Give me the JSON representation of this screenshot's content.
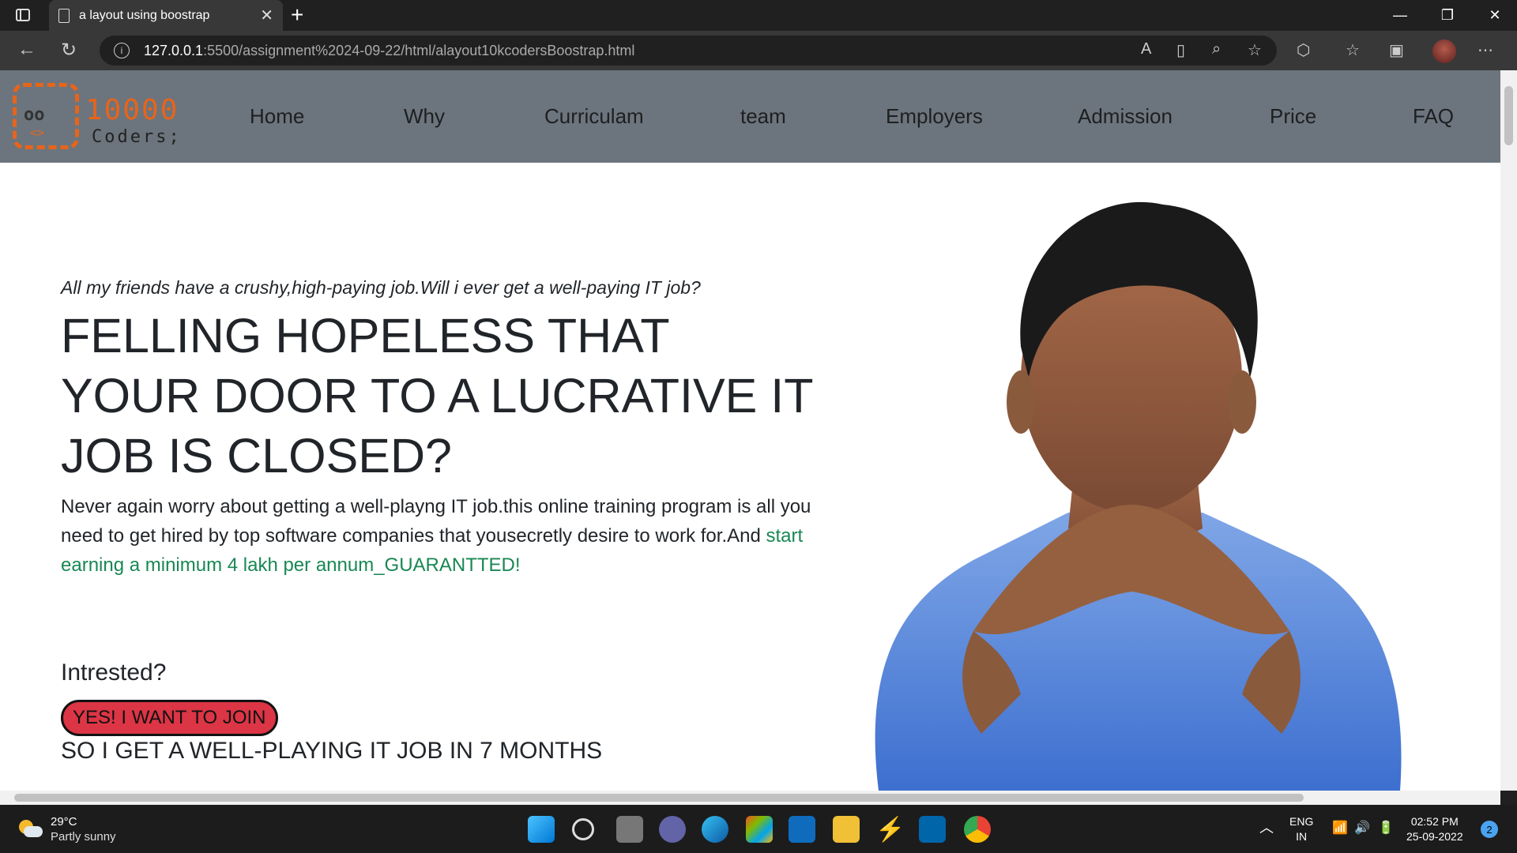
{
  "browser": {
    "tab_title": "a layout using boostrap",
    "url_host": "127.0.0.1",
    "url_path": ":5500/assignment%2024-09-22/html/alayout10kcodersBoostrap.html"
  },
  "logo": {
    "brand_line1": "10000",
    "brand_line2": "Coders;",
    "eyes": "oo",
    "tag": "<>"
  },
  "nav": {
    "items": [
      "Home",
      "Why",
      "Curriculam",
      "team",
      "Employers",
      "Admission",
      "Price",
      "FAQ"
    ]
  },
  "hero": {
    "tagline": "All my friends have a crushy,high-paying job.Will i ever get a well-paying IT job?",
    "headline": "FELLING HOPELESS THAT YOUR DOOR TO A LUCRATIVE IT JOB IS CLOSED?",
    "description": "Never again worry about getting a well-playng IT job.this online training program is all you need to get hired by top software companies that yousecretly desire to work for.And ",
    "description_highlight": "start earning a minimum 4 lakh per annum_GUARANTTED!",
    "interested_label": "Intrested?",
    "join_button": "YES! I WANT TO JOIN",
    "subheading": "SO I GET A WELL-PLAYING IT JOB IN 7 MONTHS"
  },
  "taskbar": {
    "weather_temp": "29°C",
    "weather_cond": "Partly sunny",
    "lang_1": "ENG",
    "lang_2": "IN",
    "time": "02:52 PM",
    "date": "25-09-2022",
    "notifications": "2"
  },
  "colors": {
    "navbar": "#6c757d",
    "join_button": "#dc3545",
    "highlight": "#198754"
  }
}
